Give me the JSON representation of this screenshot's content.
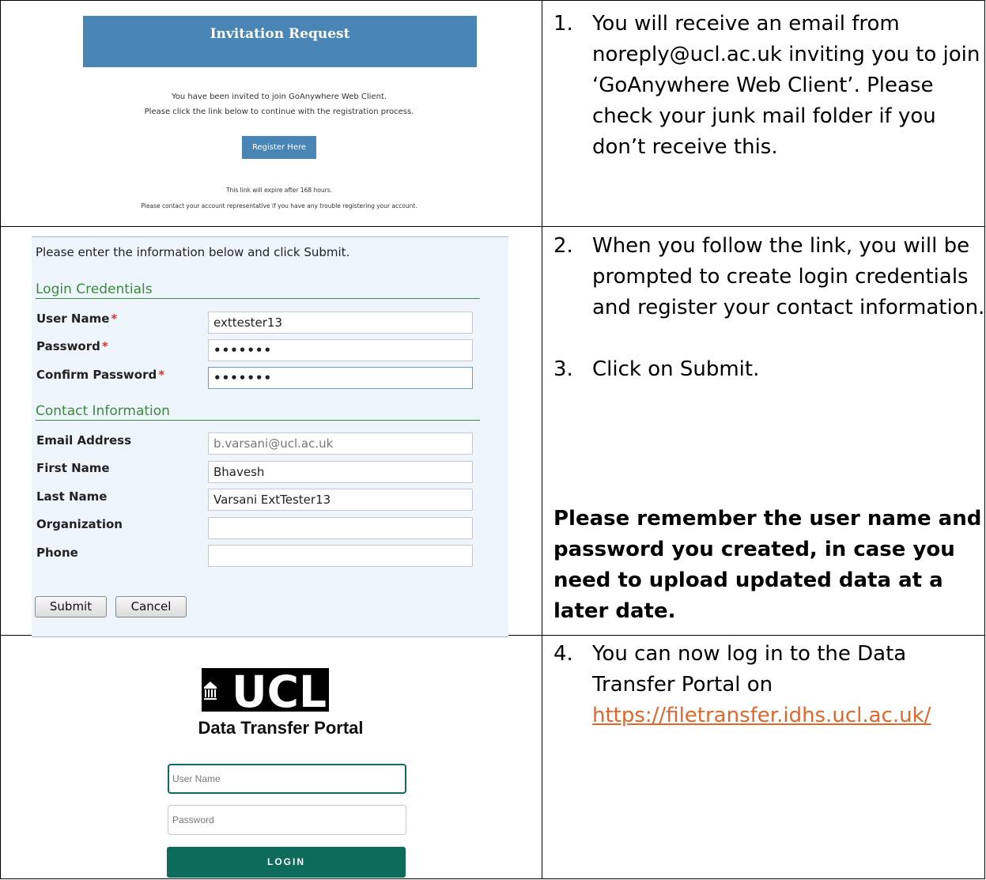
{
  "steps": [
    {
      "num": "1.",
      "text": "You will receive an email from noreply@ucl.ac.uk inviting you to join ‘GoAnywhere Web Client’. Please check your junk mail folder if you don’t receive this."
    },
    {
      "num": "2.",
      "text": "When you follow the link, you will be prompted to create login credentials and register your contact information."
    },
    {
      "num": "3.",
      "text": "Click on Submit."
    },
    {
      "num": "4.",
      "text_before": "You can now log in to the Data Transfer Portal on",
      "link": "https://filetransfer.idhs.ucl.ac.uk/"
    }
  ],
  "reminder": "Please remember the user name and password you created, in case you need to upload updated data at a later date.",
  "email": {
    "banner_title": "Invitation Request",
    "line1": "You have been invited to join GoAnywhere Web Client.",
    "line2": "Please click the link below to continue with the registration process.",
    "button": "Register Here",
    "footer1": "This link will expire after 168 hours.",
    "footer2": "Please contact your account representative if you have any trouble registering your account."
  },
  "form": {
    "intro": "Please enter the information below and click Submit.",
    "section_login": "Login Credentials",
    "section_contact": "Contact Information",
    "required_mark": "*",
    "fields": {
      "username": {
        "label": "User Name",
        "value": "exttester13"
      },
      "password": {
        "label": "Password",
        "value": "•••••••"
      },
      "confirm": {
        "label": "Confirm Password",
        "value": "•••••••"
      },
      "email": {
        "label": "Email Address",
        "value": "b.varsani@ucl.ac.uk"
      },
      "first": {
        "label": "First Name",
        "value": "Bhavesh"
      },
      "last": {
        "label": "Last Name",
        "value": "Varsani ExtTester13"
      },
      "org": {
        "label": "Organization",
        "value": ""
      },
      "phone": {
        "label": "Phone",
        "value": ""
      }
    },
    "submit": "Submit",
    "cancel": "Cancel"
  },
  "portal": {
    "logo_text": "UCL",
    "title": "Data Transfer Portal",
    "username_placeholder": "User Name",
    "password_placeholder": "Password",
    "login": "LOGIN"
  },
  "colors": {
    "email_blue": "#4a86b5",
    "form_green": "#3b8a3b",
    "portal_green": "#0c6b5a",
    "link_orange": "#e0672c",
    "required_red": "#d9342b"
  }
}
